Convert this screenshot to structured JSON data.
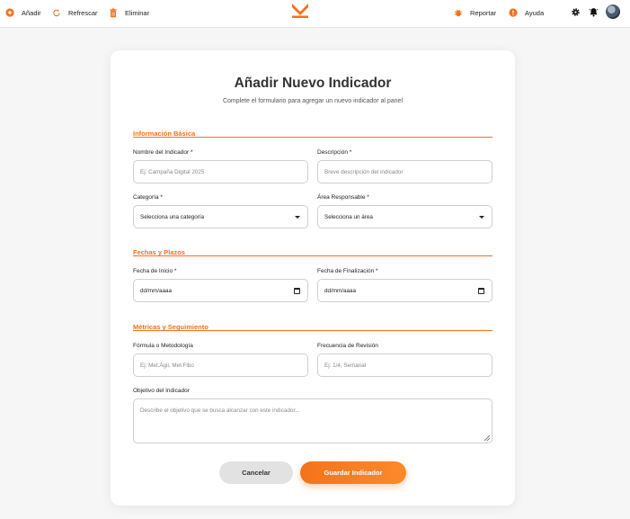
{
  "toolbar": {
    "add_label": "Añadir",
    "refresh_label": "Refrescar",
    "delete_label": "Eliminar",
    "report_label": "Reportar",
    "help_label": "Ayuda"
  },
  "form": {
    "title": "Añadir Nuevo Indicador",
    "subtitle": "Complete el formulario para agregar un nuevo indicador al panel",
    "sections": {
      "basic": "Información Básica",
      "dates": "Fechas y Plazos",
      "metrics": "Métricas y Seguimiento"
    },
    "fields": {
      "name": {
        "label": "Nombre del Indicador *",
        "placeholder": "Ej: Campaña Digital 2025"
      },
      "description": {
        "label": "Descripción *",
        "placeholder": "Breve descripción del indicador"
      },
      "category": {
        "label": "Categoría *",
        "value": "Selecciona una categoría"
      },
      "area": {
        "label": "Área Responsable *",
        "value": "Selecciona un área"
      },
      "start_date": {
        "label": "Fecha de Inicio *",
        "value": "dd/mm/aaaa"
      },
      "end_date": {
        "label": "Fecha de Finalización *",
        "value": "dd/mm/aaaa"
      },
      "formula": {
        "label": "Fórmula o Metodología",
        "placeholder": "Ej: Met.Ágil, Met.Fibo"
      },
      "frequency": {
        "label": "Frecuencia de Revisión",
        "placeholder": "Ej: 1/4, Semanal"
      },
      "objective": {
        "label": "Objetivo del Indicador",
        "placeholder": "Describe el objetivo que se busca alcanzar con este indicador..."
      }
    },
    "cancel_label": "Cancelar",
    "save_label": "Guardar Indicador"
  },
  "colors": {
    "accent": "#f2711c",
    "background": "#f6f6f7"
  }
}
